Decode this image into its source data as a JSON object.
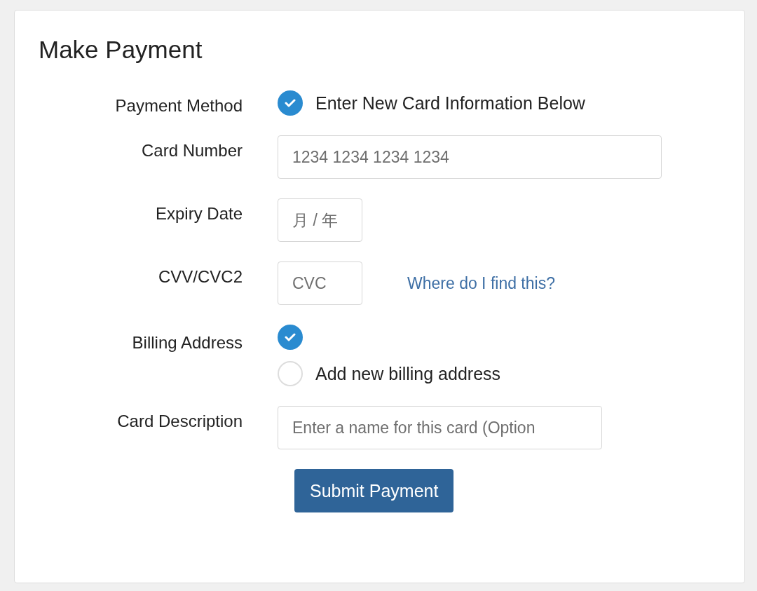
{
  "title": "Make Payment",
  "payment_method": {
    "label": "Payment Method",
    "options": [
      {
        "label": "Enter New Card Information Below",
        "selected": true
      }
    ]
  },
  "card_number": {
    "label": "Card Number",
    "placeholder": "1234 1234 1234 1234"
  },
  "expiry_date": {
    "label": "Expiry Date",
    "placeholder": "月 / 年"
  },
  "cvv": {
    "label": "CVV/CVC2",
    "placeholder": "CVC",
    "help_link": "Where do I find this?"
  },
  "billing_address": {
    "label": "Billing Address",
    "options": [
      {
        "selected": true
      },
      {
        "label": "Add new billing address",
        "selected": false
      }
    ]
  },
  "card_description": {
    "label": "Card Description",
    "placeholder": "Enter a name for this card (Option"
  },
  "submit_button": "Submit Payment"
}
